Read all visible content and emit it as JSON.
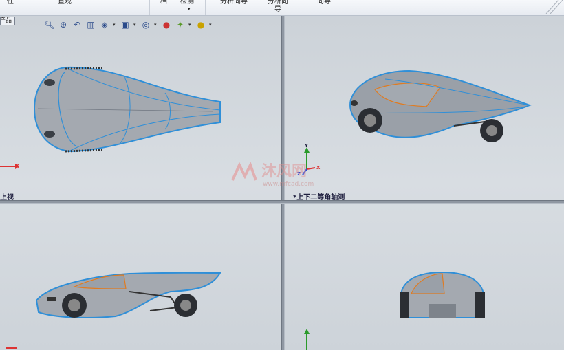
{
  "toolbar": {
    "items": [
      {
        "label": "性"
      },
      {
        "label": "直观"
      },
      {
        "label": "档"
      },
      {
        "label": "检测"
      },
      {
        "label": "分析向导"
      },
      {
        "label": "分析向导"
      },
      {
        "label": "向导"
      }
    ]
  },
  "feature_tree_tab": {
    "label": "产品"
  },
  "heads_up_toolbar": {
    "icons": [
      "zoom-to-fit-icon",
      "zoom-area-icon",
      "previous-view-icon",
      "section-view-icon",
      "view-orientation-icon",
      "display-style-icon",
      "hide-show-icon",
      "edit-appearance-icon",
      "apply-scene-icon",
      "view-settings-icon"
    ]
  },
  "viewports": {
    "top_left": {
      "label": "上视",
      "axis": "X"
    },
    "top_right": {
      "label": "*上下二等角轴测",
      "axis_x": "X",
      "axis_y": "Y",
      "axis_z": "Z"
    },
    "bottom_left": {
      "label": ""
    },
    "bottom_right": {
      "label": ""
    }
  },
  "watermark": {
    "brand": "沐风网",
    "url": "www.mfcad.com"
  },
  "colors": {
    "accent_edge": "#2f8fd8",
    "body": "#9aa0a8",
    "orange_edge": "#e07b20"
  }
}
